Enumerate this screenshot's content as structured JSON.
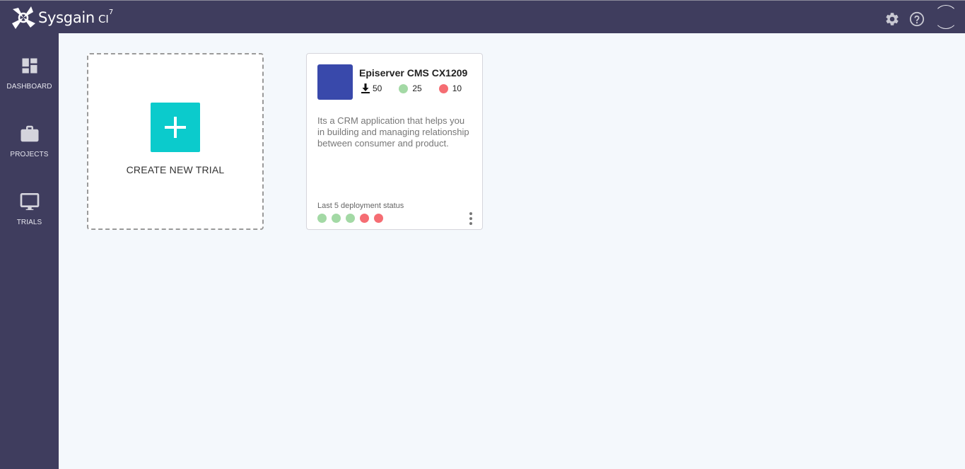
{
  "app": {
    "brand_name": "Sysgain",
    "brand_sub": "CI",
    "brand_sup": "7"
  },
  "header": {
    "icons": [
      "gear-icon",
      "help-icon",
      "user-avatar"
    ]
  },
  "sidebar": {
    "items": [
      {
        "label": "DASHBOARD",
        "icon": "dashboard-icon"
      },
      {
        "label": "PROJECTS",
        "icon": "briefcase-icon"
      },
      {
        "label": "TRIALS",
        "icon": "monitor-icon"
      }
    ]
  },
  "create_card": {
    "label": "CREATE NEW TRIAL",
    "icon": "plus-icon"
  },
  "trial": {
    "title": "Episerver CMS CX1209",
    "downloads": "50",
    "success_count": "25",
    "failure_count": "10",
    "description": "Its a CRM application that helps you in building and managing relationship between consumer and product.",
    "status_label": "Last 5 deployment status",
    "last_statuses": [
      "success",
      "success",
      "success",
      "failure",
      "failure"
    ]
  },
  "colors": {
    "nav_bg": "#3f3d5e",
    "content_bg": "#f4f8fc",
    "accent_teal": "#0bcbcc",
    "thumb_blue": "#3949ab",
    "success": "#a3d9a5",
    "failure": "#f56d73"
  }
}
